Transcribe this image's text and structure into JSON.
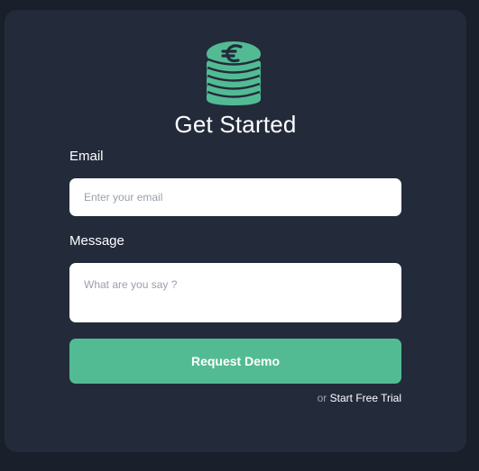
{
  "colors": {
    "page_background": "#1a1f2c",
    "card_background": "#232b3b",
    "accent": "#53bb94",
    "field_background": "#ffffff"
  },
  "logo": {
    "icon": "euro-coin-stack-icon"
  },
  "header": {
    "title": "Get Started"
  },
  "form": {
    "email_label": "Email",
    "email_placeholder": "Enter your email",
    "message_label": "Message",
    "message_placeholder": "What are you say ?",
    "submit_label": "Request Demo"
  },
  "footer": {
    "prefix": "or",
    "trial_link": "Start Free Trial"
  }
}
